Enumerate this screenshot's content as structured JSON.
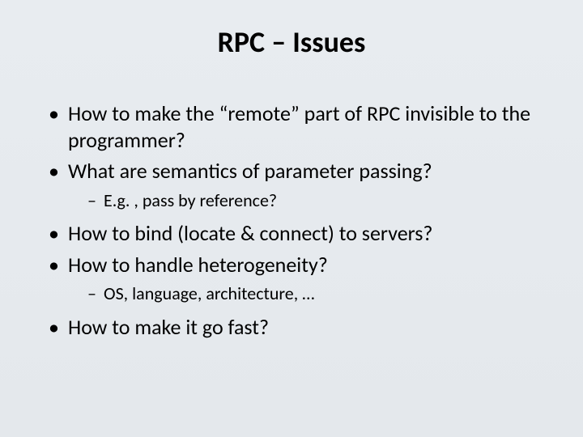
{
  "slide": {
    "title": "RPC – Issues",
    "bullets": [
      {
        "text": "How to make the “remote” part of RPC invisible to the programmer?",
        "sub": []
      },
      {
        "text": "What are semantics of parameter passing?",
        "sub": [
          "E.g. , pass by reference?"
        ]
      },
      {
        "text": "How to bind (locate & connect) to servers?",
        "sub": []
      },
      {
        "text": "How to handle heterogeneity?",
        "sub": [
          "OS, language, architecture, …"
        ]
      },
      {
        "text": "How to make it go fast?",
        "sub": []
      }
    ]
  }
}
